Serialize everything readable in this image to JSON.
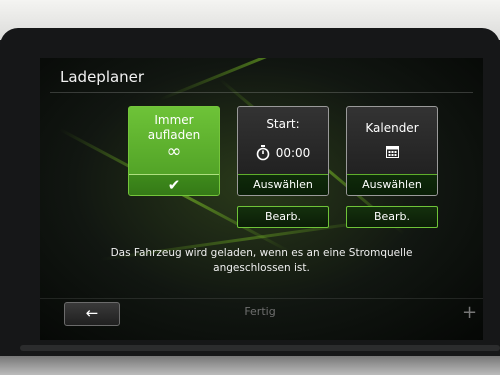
{
  "screen": {
    "title": "Ladeplaner"
  },
  "tiles": {
    "always": {
      "label": "Immer aufladen",
      "symbol": "∞",
      "check": "✔"
    },
    "start": {
      "label": "Start:",
      "time": "00:00",
      "select_label": "Auswählen",
      "edit_label": "Bearb."
    },
    "calendar": {
      "label": "Kalender",
      "select_label": "Auswählen",
      "edit_label": "Bearb."
    }
  },
  "message": "Das Fahrzeug wird geladen, wenn es an eine Stromquelle angeschlossen ist.",
  "footer": {
    "back_symbol": "←",
    "done_label": "Fertig",
    "plus_symbol": "+"
  },
  "colors": {
    "accent_green": "#6ec338",
    "selected_tile": "#5aa82c"
  }
}
